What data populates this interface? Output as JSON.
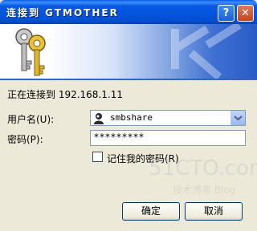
{
  "window": {
    "title": "连接到 GTMOTHER"
  },
  "titlebar": {
    "help_glyph": "?",
    "close_glyph": "✕"
  },
  "dialog": {
    "connecting_text": "正在连接到 192.168.1.11",
    "username_label": "用户名(U):",
    "username_value": "smbshare",
    "password_label": "密码(P):",
    "password_value": "*********",
    "remember_label": "记住我的密码(R)",
    "remember_checked": false
  },
  "buttons": {
    "ok": "确定",
    "cancel": "取消"
  },
  "watermark": {
    "main": "51CTO.com",
    "sub": "技术博客 Blog"
  },
  "colors": {
    "titlebar": "#0654dc",
    "dialog_bg": "#ece9d8",
    "banner_accent": "#2f67c9"
  }
}
